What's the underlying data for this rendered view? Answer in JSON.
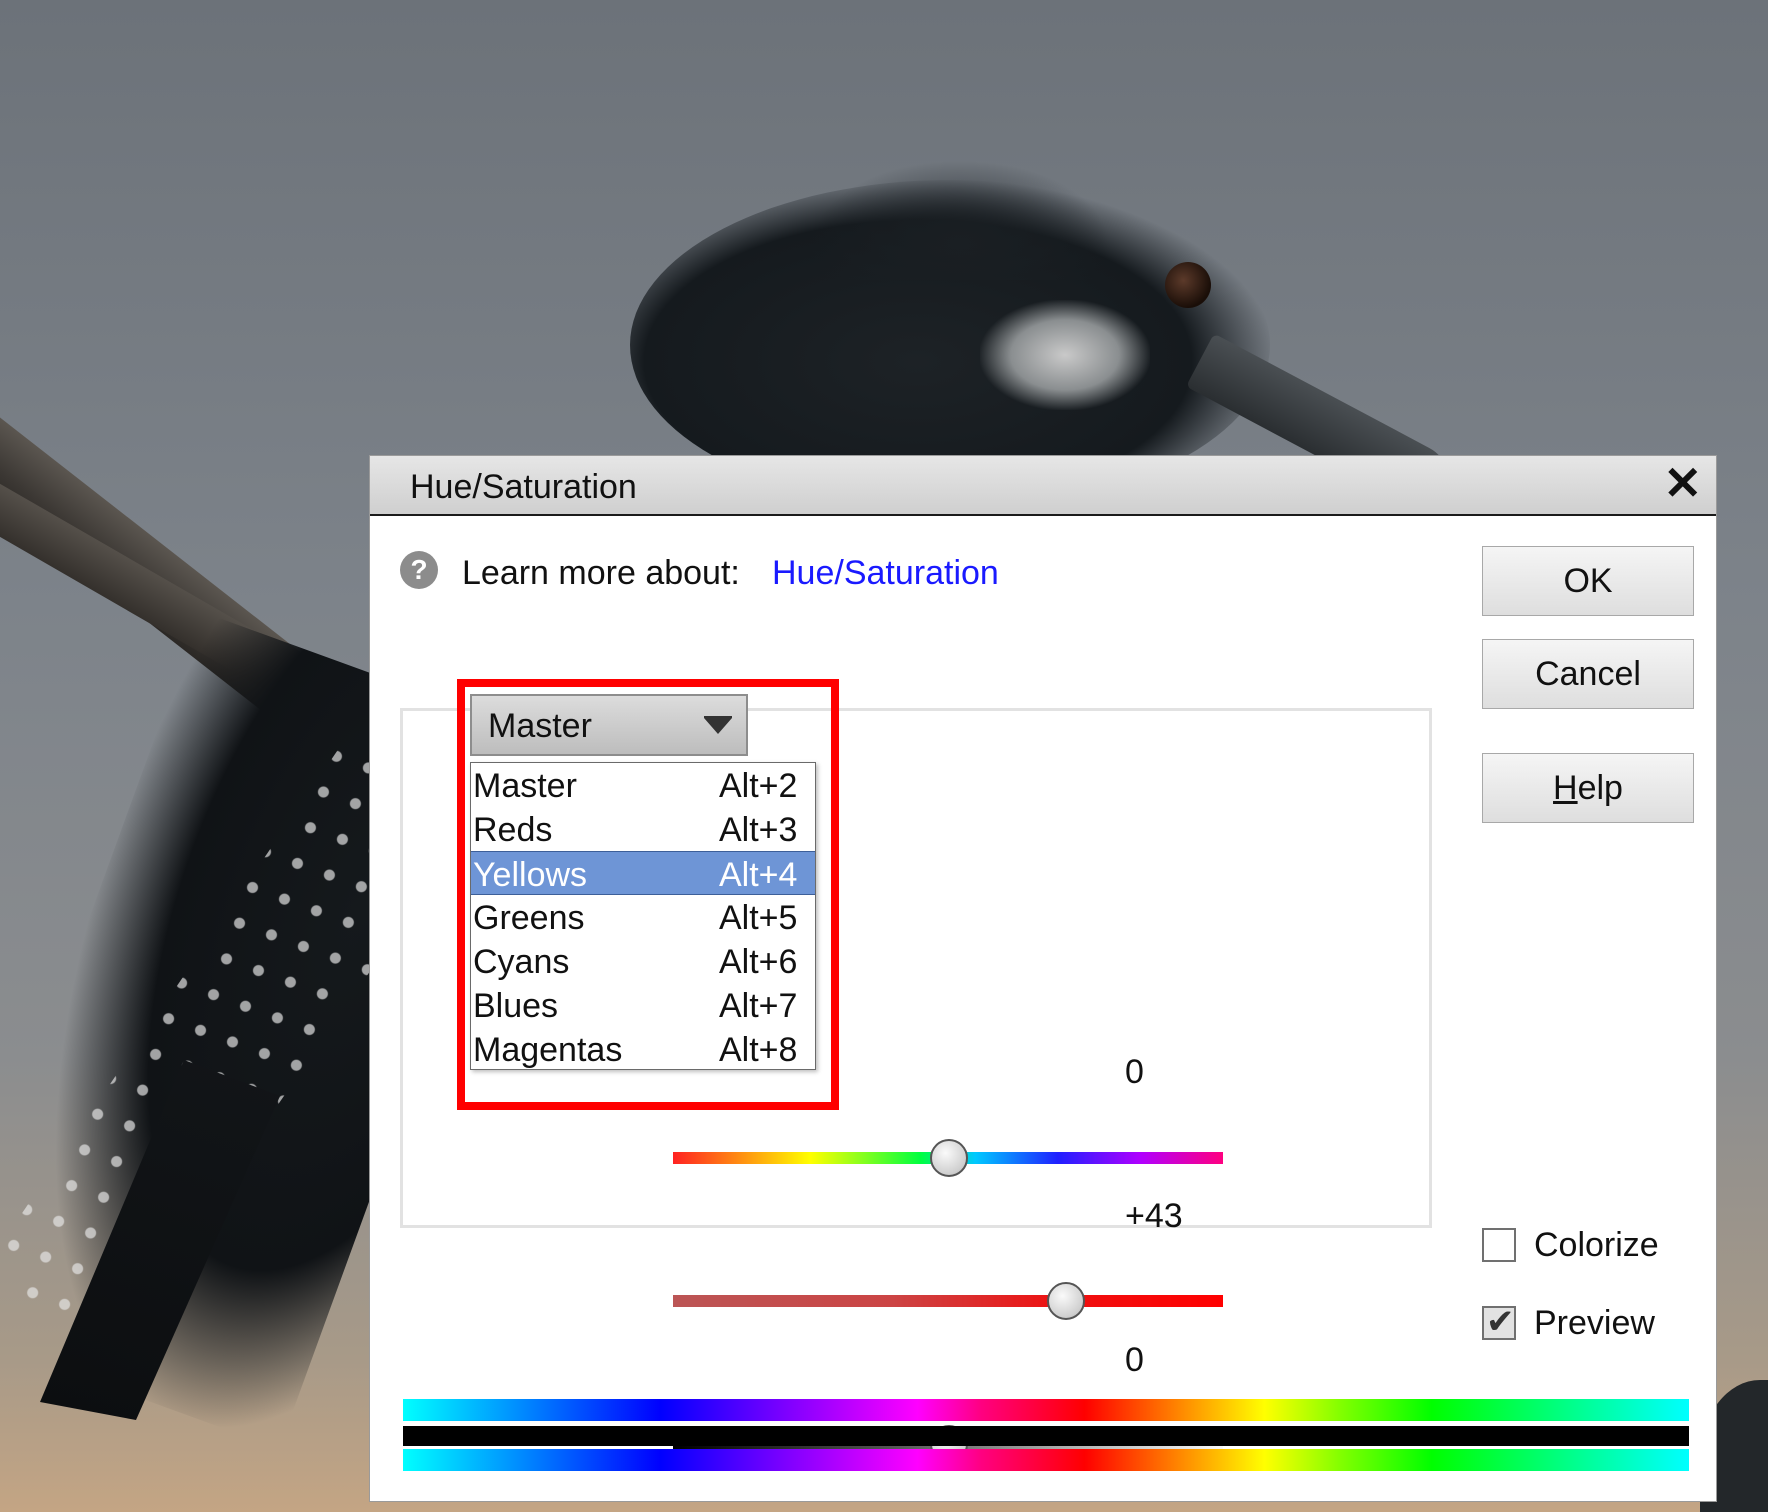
{
  "dialog": {
    "title": "Hue/Saturation",
    "close_glyph": "✕",
    "learn_more_label": "Learn more about:",
    "learn_more_link": "Hue/Saturation",
    "help_icon_glyph": "?"
  },
  "buttons": {
    "ok": "OK",
    "cancel": "Cancel",
    "help_underlined": "H",
    "help_rest": "elp"
  },
  "channel_select": {
    "selected": "Master",
    "options": [
      {
        "name": "Master",
        "shortcut": "Alt+2"
      },
      {
        "name": "Reds",
        "shortcut": "Alt+3"
      },
      {
        "name": "Yellows",
        "shortcut": "Alt+4"
      },
      {
        "name": "Greens",
        "shortcut": "Alt+5"
      },
      {
        "name": "Cyans",
        "shortcut": "Alt+6"
      },
      {
        "name": "Blues",
        "shortcut": "Alt+7"
      },
      {
        "name": "Magentas",
        "shortcut": "Alt+8"
      }
    ],
    "highlighted_option": "Yellows"
  },
  "sliders": {
    "hue": {
      "value_text": "0"
    },
    "saturation": {
      "value_text": "+43"
    },
    "lightness": {
      "value_text": "0"
    }
  },
  "checkboxes": {
    "colorize": {
      "label": "Colorize",
      "checked": false
    },
    "preview": {
      "label": "Preview",
      "checked": true
    }
  },
  "colors": {
    "highlight_border": "#ff0000",
    "selection": "#6e95d6",
    "link": "#1a1aff"
  }
}
